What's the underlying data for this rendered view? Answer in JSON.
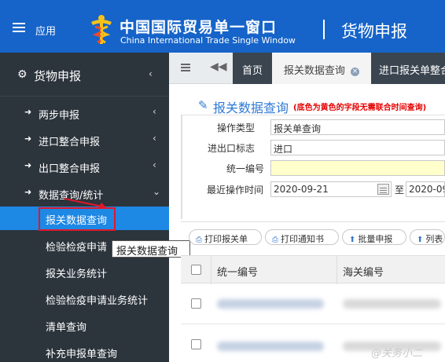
{
  "header": {
    "app_label": "应用",
    "title_cn": "中国国际贸易单一窗口",
    "title_en": "China International Trade Single Window",
    "module_title": "货物申报",
    "color": "#1664c9"
  },
  "sidebar": {
    "top_label": "货物申报",
    "items": [
      {
        "label": "两步申报",
        "icon": "sign-in-icon"
      },
      {
        "label": "进口整合申报",
        "icon": "sign-in-icon"
      },
      {
        "label": "出口整合申报",
        "icon": "sign-out-icon"
      },
      {
        "label": "数据查询/统计",
        "icon": "sign-in-icon"
      }
    ],
    "subitems": [
      {
        "label": "报关数据查询",
        "active": true
      },
      {
        "label": "检验检疫申请"
      },
      {
        "label": "报关业务统计"
      },
      {
        "label": "检验检疫申请业务统计"
      },
      {
        "label": "清单查询"
      },
      {
        "label": "补充申报单查询"
      }
    ],
    "tooltip": "报关数据查询",
    "bg": "#2c343c",
    "active_bg": "#1e88e5"
  },
  "tabs": {
    "items": [
      {
        "label": "首页"
      },
      {
        "label": "报关数据查询",
        "active": true
      },
      {
        "label": "进口报关单整合"
      }
    ]
  },
  "form": {
    "title": "报关数据查询",
    "note": "(底色为黄色的字段无需联合时间查询)",
    "fields": {
      "op_type_label": "操作类型",
      "op_type_value": "报关单查询",
      "ie_flag_label": "进出口标志",
      "ie_flag_value": "进口",
      "unified_no_label": "统一编号",
      "unified_no_value": "",
      "recent_time_label": "最近操作时间",
      "date_from": "2020-09-21",
      "date_sep": "至",
      "date_to": "2020-09"
    }
  },
  "toolbar": {
    "buttons": [
      {
        "label": "打印报关单"
      },
      {
        "label": "打印通知书"
      },
      {
        "label": "批量申报"
      },
      {
        "label": "列表"
      }
    ]
  },
  "table": {
    "headers": [
      "统一编号",
      "海关编号"
    ]
  },
  "watermark": "@关务小二"
}
